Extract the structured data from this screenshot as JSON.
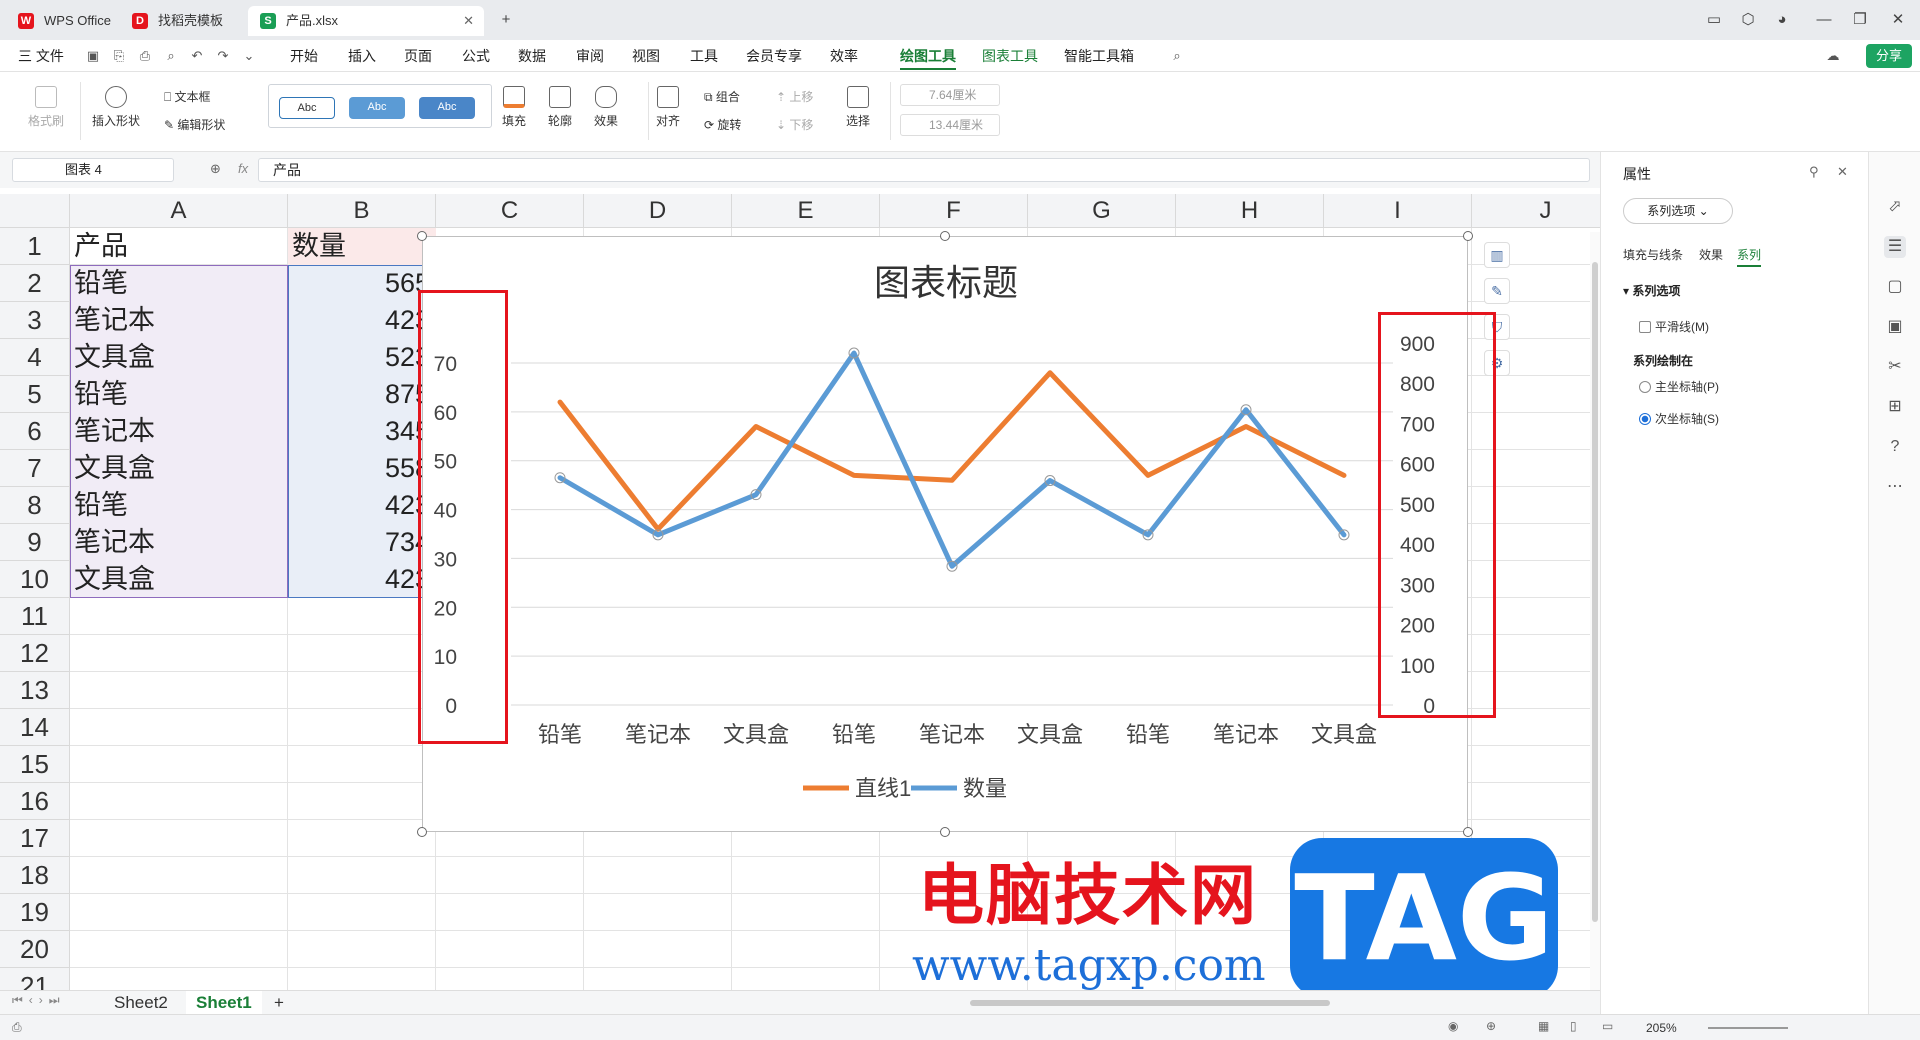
{
  "titlebar": {
    "tabs": [
      {
        "label": "WPS Office",
        "active": false
      },
      {
        "label": "找稻壳模板",
        "active": false
      },
      {
        "label": "产品.xlsx",
        "active": true
      }
    ],
    "new_tab": "+"
  },
  "menu": {
    "file": "三 文件",
    "items": [
      "开始",
      "插入",
      "页面",
      "公式",
      "数据",
      "审阅",
      "视图",
      "工具",
      "会员专享",
      "效率"
    ],
    "context": [
      "绘图工具",
      "图表工具"
    ],
    "ai": "智能工具箱",
    "share": "分享"
  },
  "ribbon": {
    "format_painter": "格式刷",
    "insert_shape": "插入形状",
    "text_box": "文本框",
    "edit_shape": "编辑形状",
    "style_samples": [
      "Abc",
      "Abc",
      "Abc"
    ],
    "fill": "填充",
    "outline": "轮廓",
    "effect": "效果",
    "align": "对齐",
    "group": "组合",
    "rotate": "旋转",
    "bring_up": "上移",
    "send_down": "下移",
    "select": "选择",
    "height": "7.64厘米",
    "width": "13.44厘米"
  },
  "formula_bar": {
    "name_box": "图表 4",
    "fx": "fx",
    "content": "产品"
  },
  "sheet": {
    "columns": [
      "A",
      "B",
      "C",
      "D",
      "E",
      "F",
      "G",
      "H",
      "I",
      "J"
    ],
    "rows": [
      "1",
      "2",
      "3",
      "4",
      "5",
      "6",
      "7",
      "8",
      "9",
      "10",
      "11",
      "12",
      "13",
      "14",
      "15",
      "16",
      "17",
      "18",
      "19",
      "20",
      "21"
    ],
    "header_a": "产品",
    "header_b": "数量",
    "products": [
      "铅笔",
      "笔记本",
      "文具盒",
      "铅笔",
      "笔记本",
      "文具盒",
      "铅笔",
      "笔记本",
      "文具盒"
    ],
    "quantities": [
      "565",
      "423",
      "523",
      "875",
      "345",
      "558",
      "423",
      "734",
      "423"
    ]
  },
  "chart_data": {
    "type": "line",
    "title": "图表标题",
    "categories": [
      "铅笔",
      "笔记本",
      "文具盒",
      "铅笔",
      "笔记本",
      "文具盒",
      "铅笔",
      "笔记本",
      "文具盒"
    ],
    "series": [
      {
        "name": "直线1",
        "axis": "primary",
        "color": "#ed7d31",
        "values": [
          62,
          36,
          57,
          47,
          46,
          68,
          47,
          57,
          47
        ]
      },
      {
        "name": "数量",
        "axis": "secondary",
        "color": "#5b9bd5",
        "values": [
          565,
          423,
          523,
          875,
          345,
          558,
          423,
          734,
          423
        ]
      }
    ],
    "y_primary": {
      "min": 0,
      "max": 70,
      "ticks": [
        "0",
        "10",
        "20",
        "30",
        "40",
        "50",
        "60",
        "70"
      ]
    },
    "y_secondary": {
      "min": 0,
      "max": 900,
      "ticks": [
        "0",
        "100",
        "200",
        "300",
        "400",
        "500",
        "600",
        "700",
        "800",
        "900"
      ]
    },
    "grid": true,
    "legend": "bottom"
  },
  "sheet_tabs": {
    "tabs": [
      "Sheet2",
      "Sheet1"
    ],
    "active": "Sheet1",
    "add": "+"
  },
  "status": {
    "zoom": "205%"
  },
  "panel": {
    "title": "属性",
    "dropdown": "系列选项",
    "tabs": [
      "填充与线条",
      "效果",
      "系列"
    ],
    "active_tab": "系列",
    "section_options": "系列选项",
    "smooth": "平滑线(M)",
    "section_plot_on": "系列绘制在",
    "primary_axis": "主坐标轴(P)",
    "secondary_axis": "次坐标轴(S)",
    "selected_axis": "secondary"
  },
  "watermark": {
    "text": "电脑技术网",
    "url": "www.tagxp.com",
    "badge": "TAG"
  },
  "colors": {
    "accent": "#1a7f37",
    "highlight_red": "#e5141d",
    "orange_series": "#ed7d31",
    "blue_series": "#5b9bd5"
  }
}
